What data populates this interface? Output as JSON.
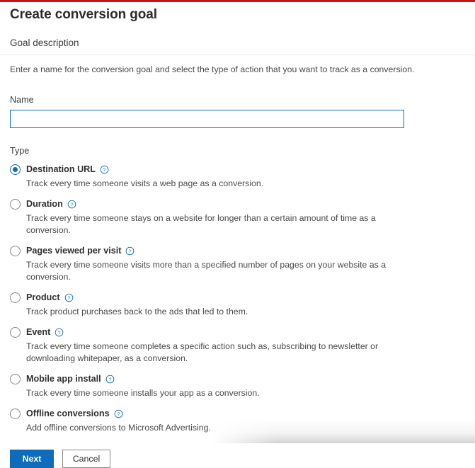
{
  "theme": {
    "accent_blue": "#0f6cbd",
    "top_rule_red": "#c5161c",
    "text_dark": "#2f2f2f",
    "text_gray": "#4a4a4a",
    "radio_unchecked_border": "#8a8886"
  },
  "page": {
    "title": "Create conversion goal"
  },
  "section": {
    "heading": "Goal description",
    "intro": "Enter a name for the conversion goal and select the type of action that you want to track as a conversion."
  },
  "name_field": {
    "label": "Name",
    "value": "",
    "placeholder": ""
  },
  "type_field": {
    "label": "Type",
    "selected_index": 0,
    "help_icon": "help-circle-icon",
    "options": [
      {
        "label": "Destination URL",
        "description": "Track every time someone visits a web page as a conversion.",
        "checked": true
      },
      {
        "label": "Duration",
        "description": "Track every time someone stays on a website for longer than a certain amount of time as a conversion.",
        "checked": false
      },
      {
        "label": "Pages viewed per visit",
        "description": "Track every time someone visits more than a specified number of pages on your website as a conversion.",
        "checked": false
      },
      {
        "label": "Product",
        "description": "Track product purchases back to the ads that led to them.",
        "checked": false
      },
      {
        "label": "Event",
        "description": "Track every time someone completes a specific action such as, subscribing to newsletter or downloading whitepaper, as a conversion.",
        "checked": false
      },
      {
        "label": "Mobile app install",
        "description": "Track every time someone installs your app as a conversion.",
        "checked": false
      },
      {
        "label": "Offline conversions",
        "description": "Add offline conversions to Microsoft Advertising.",
        "checked": false
      }
    ]
  },
  "footer": {
    "next_label": "Next",
    "cancel_label": "Cancel"
  }
}
